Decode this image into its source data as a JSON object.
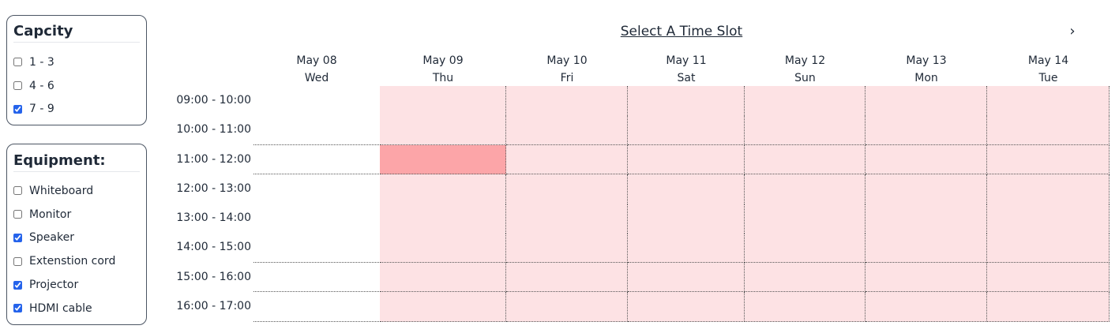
{
  "capacity": {
    "title": "Capcity",
    "options": [
      {
        "label": "1 - 3",
        "checked": false
      },
      {
        "label": "4 - 6",
        "checked": false
      },
      {
        "label": "7 - 9",
        "checked": true
      }
    ]
  },
  "equipment": {
    "title": "Equipment:",
    "options": [
      {
        "label": "Whiteboard",
        "checked": false
      },
      {
        "label": "Monitor",
        "checked": false
      },
      {
        "label": "Speaker",
        "checked": true
      },
      {
        "label": "Extenstion cord",
        "checked": false
      },
      {
        "label": "Projector",
        "checked": true
      },
      {
        "label": "HDMI cable",
        "checked": true
      }
    ]
  },
  "calendar": {
    "title": "Select A Time Slot",
    "next_icon": "chevron-right-icon",
    "next_glyph": "›",
    "days": [
      {
        "date": "May 08",
        "weekday": "Wed"
      },
      {
        "date": "May 09",
        "weekday": "Thu"
      },
      {
        "date": "May 10",
        "weekday": "Fri"
      },
      {
        "date": "May 11",
        "weekday": "Sat"
      },
      {
        "date": "May 12",
        "weekday": "Sun"
      },
      {
        "date": "May 13",
        "weekday": "Mon"
      },
      {
        "date": "May 14",
        "weekday": "Tue"
      }
    ],
    "time_slots": [
      "09:00 - 10:00",
      "10:00 - 11:00",
      "11:00 - 12:00",
      "12:00 - 13:00",
      "13:00 - 14:00",
      "14:00 - 15:00",
      "15:00 - 16:00",
      "16:00 - 17:00"
    ],
    "slot_states": [
      [
        "available",
        "unavailable",
        "unavailable",
        "unavailable",
        "unavailable",
        "unavailable",
        "unavailable"
      ],
      [
        "available",
        "unavailable",
        "unavailable",
        "unavailable",
        "unavailable",
        "unavailable",
        "unavailable"
      ],
      [
        "available",
        "selected",
        "unavailable",
        "unavailable",
        "unavailable",
        "unavailable",
        "unavailable"
      ],
      [
        "available",
        "unavailable",
        "unavailable",
        "unavailable",
        "unavailable",
        "unavailable",
        "unavailable"
      ],
      [
        "available",
        "unavailable",
        "unavailable",
        "unavailable",
        "unavailable",
        "unavailable",
        "unavailable"
      ],
      [
        "available",
        "unavailable",
        "unavailable",
        "unavailable",
        "unavailable",
        "unavailable",
        "unavailable"
      ],
      [
        "available",
        "unavailable",
        "unavailable",
        "unavailable",
        "unavailable",
        "unavailable",
        "unavailable"
      ],
      [
        "available",
        "unavailable",
        "unavailable",
        "unavailable",
        "unavailable",
        "unavailable",
        "unavailable"
      ]
    ],
    "colors": {
      "available": "#ffffff",
      "unavailable": "#fde2e4",
      "selected": "#fca5a8"
    }
  }
}
